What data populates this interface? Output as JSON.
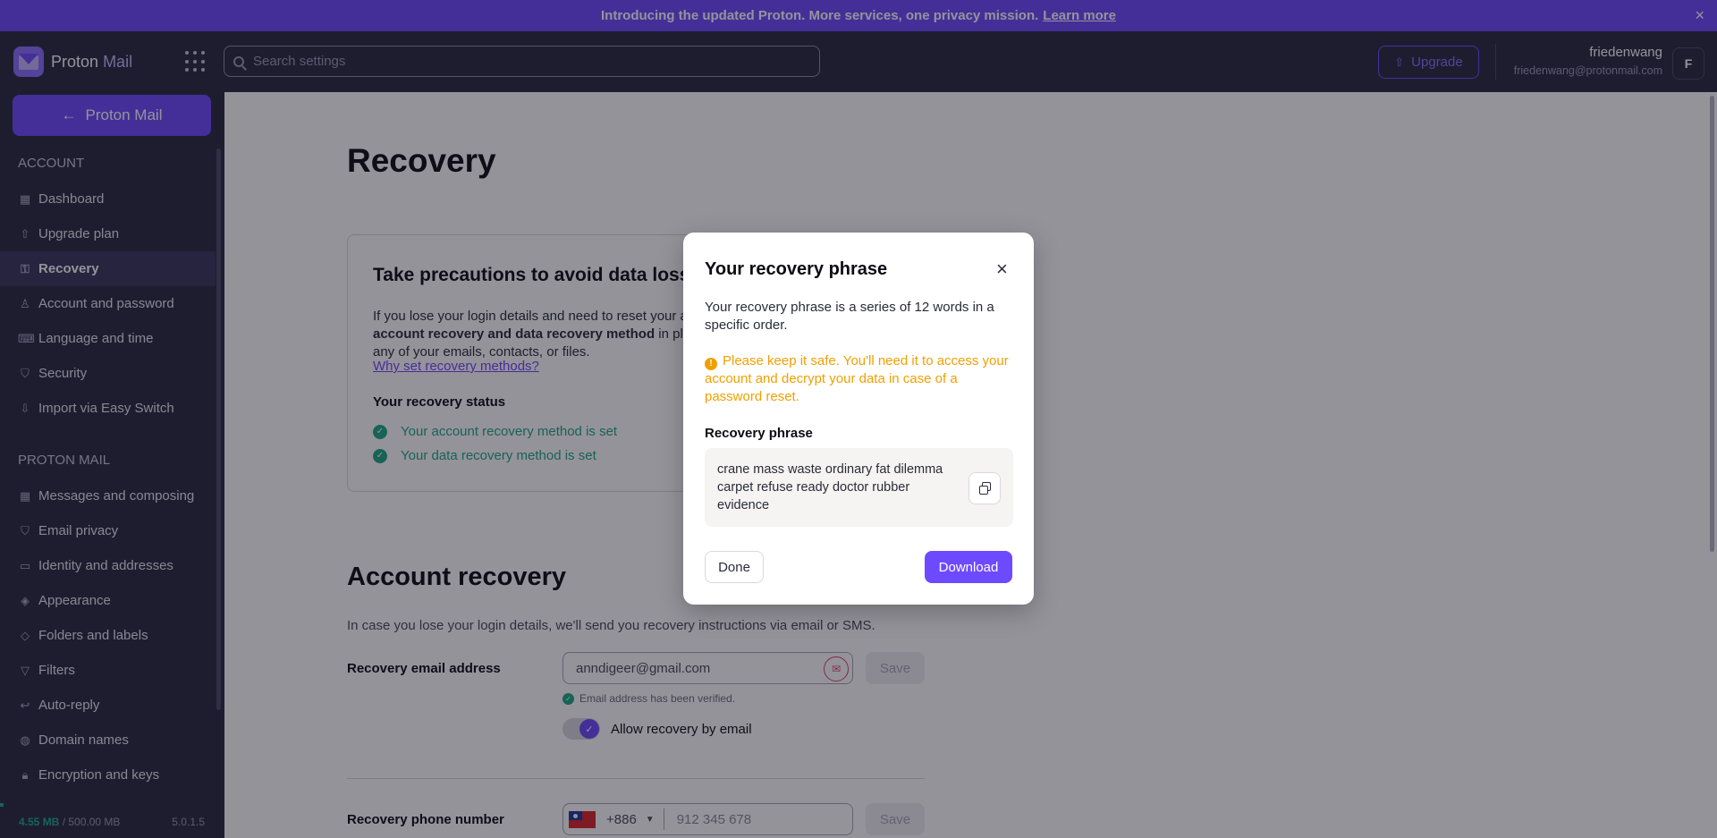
{
  "banner": {
    "text": "Introducing the updated Proton. More services, one privacy mission.",
    "link": "Learn more",
    "close": "×"
  },
  "header": {
    "logo_brand": "Proton",
    "logo_product": "Mail",
    "search_placeholder": "Search settings",
    "upgrade_label": "Upgrade",
    "user_name": "friedenwang",
    "user_email": "friedenwang@protonmail.com",
    "avatar_initial": "F"
  },
  "sidebar": {
    "back_label": "Proton Mail",
    "account_heading": "ACCOUNT",
    "account_items": [
      {
        "label": "Dashboard",
        "icon": "dashboard-icon"
      },
      {
        "label": "Upgrade plan",
        "icon": "upgrade-icon"
      },
      {
        "label": "Recovery",
        "icon": "key-icon"
      },
      {
        "label": "Account and password",
        "icon": "user-icon"
      },
      {
        "label": "Language and time",
        "icon": "keyboard-icon"
      },
      {
        "label": "Security",
        "icon": "shield-icon"
      },
      {
        "label": "Import via Easy Switch",
        "icon": "import-icon"
      }
    ],
    "mail_heading": "PROTON MAIL",
    "mail_items": [
      {
        "label": "Messages and composing",
        "icon": "grid-icon"
      },
      {
        "label": "Email privacy",
        "icon": "shield-icon"
      },
      {
        "label": "Identity and addresses",
        "icon": "id-card-icon"
      },
      {
        "label": "Appearance",
        "icon": "paint-icon"
      },
      {
        "label": "Folders and labels",
        "icon": "tag-icon"
      },
      {
        "label": "Filters",
        "icon": "filter-icon"
      },
      {
        "label": "Auto-reply",
        "icon": "reply-icon"
      },
      {
        "label": "Domain names",
        "icon": "globe-icon"
      },
      {
        "label": "Encryption and keys",
        "icon": "lock-icon"
      }
    ],
    "storage_used": "4.55 MB",
    "storage_total": "/ 500.00 MB",
    "version": "5.0.1.5"
  },
  "main": {
    "page_title": "Recovery",
    "card": {
      "title": "Take precautions to avoid data loss!",
      "desc_1": "If you lose your login details and need to reset your a",
      "desc_bold": "account recovery and data recovery method",
      "desc_2": " in plac",
      "desc_3": "any of your emails, contacts, or files.",
      "why_link": "Why set recovery methods?",
      "status_heading": "Your recovery status",
      "status_1": "Your account recovery method is set",
      "status_2": "Your data recovery method is set"
    },
    "account_recovery": {
      "title": "Account recovery",
      "desc": "In case you lose your login details, we'll send you recovery instructions via email or SMS.",
      "email_label": "Recovery email address",
      "email_value": "anndigeer@gmail.com",
      "save_label": "Save",
      "verified_text": "Email address has been verified.",
      "toggle_label": "Allow recovery by email",
      "toggle_on": true,
      "phone_label": "Recovery phone number",
      "phone_code": "+886",
      "phone_placeholder": "912 345 678"
    }
  },
  "modal": {
    "title": "Your recovery phrase",
    "close": "×",
    "description": "Your recovery phrase is a series of 12 words in a specific order.",
    "warning": "Please keep it safe. You'll need it to access your account and decrypt your data in case of a password reset.",
    "phrase_label": "Recovery phrase",
    "phrase": "crane mass waste ordinary fat dilemma carpet refuse ready doctor rubber evidence",
    "done_label": "Done",
    "download_label": "Download"
  },
  "colors": {
    "accent": "#6d4aff",
    "header_bg": "#292841",
    "success": "#1ea885",
    "warning": "#f0a000"
  }
}
